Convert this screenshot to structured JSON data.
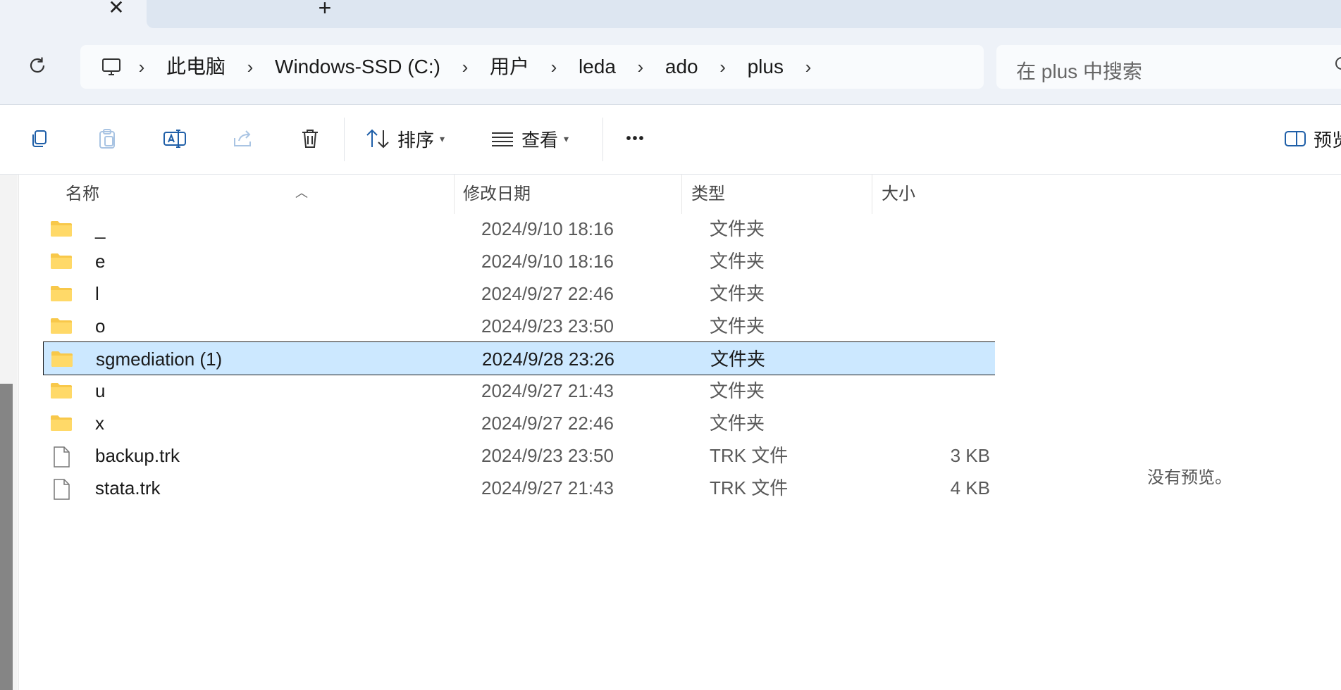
{
  "titlebar": {
    "close_glyph": "✕",
    "new_tab_glyph": "+"
  },
  "address": {
    "refresh_icon": "refresh-icon",
    "pc_icon": "this-pc-icon",
    "crumbs": [
      "此电脑",
      "Windows-SSD (C:)",
      "用户",
      "leda",
      "ado",
      "plus"
    ],
    "chevron": "›"
  },
  "search": {
    "placeholder": "在 plus 中搜索"
  },
  "toolbar": {
    "sort_label": "排序",
    "view_label": "查看",
    "more_label": "•••",
    "details_label": "预览"
  },
  "columns": {
    "name": "名称",
    "date": "修改日期",
    "type": "类型",
    "size": "大小"
  },
  "files": [
    {
      "name": "_",
      "date": "2024/9/10 18:16",
      "type": "文件夹",
      "size": "",
      "kind": "folder"
    },
    {
      "name": "e",
      "date": "2024/9/10 18:16",
      "type": "文件夹",
      "size": "",
      "kind": "folder"
    },
    {
      "name": "l",
      "date": "2024/9/27 22:46",
      "type": "文件夹",
      "size": "",
      "kind": "folder"
    },
    {
      "name": "o",
      "date": "2024/9/23 23:50",
      "type": "文件夹",
      "size": "",
      "kind": "folder"
    },
    {
      "name": "sgmediation (1)",
      "date": "2024/9/28 23:26",
      "type": "文件夹",
      "size": "",
      "kind": "folder",
      "selected": true
    },
    {
      "name": "u",
      "date": "2024/9/27 21:43",
      "type": "文件夹",
      "size": "",
      "kind": "folder"
    },
    {
      "name": "x",
      "date": "2024/9/27 22:46",
      "type": "文件夹",
      "size": "",
      "kind": "folder"
    },
    {
      "name": "backup.trk",
      "date": "2024/9/23 23:50",
      "type": "TRK 文件",
      "size": "3 KB",
      "kind": "file"
    },
    {
      "name": "stata.trk",
      "date": "2024/9/27 21:43",
      "type": "TRK 文件",
      "size": "4 KB",
      "kind": "file"
    }
  ],
  "preview": {
    "empty_text": "没有预览。"
  },
  "colors": {
    "selection_bg": "#cce8ff",
    "folder_yellow": "#f8c84a"
  }
}
